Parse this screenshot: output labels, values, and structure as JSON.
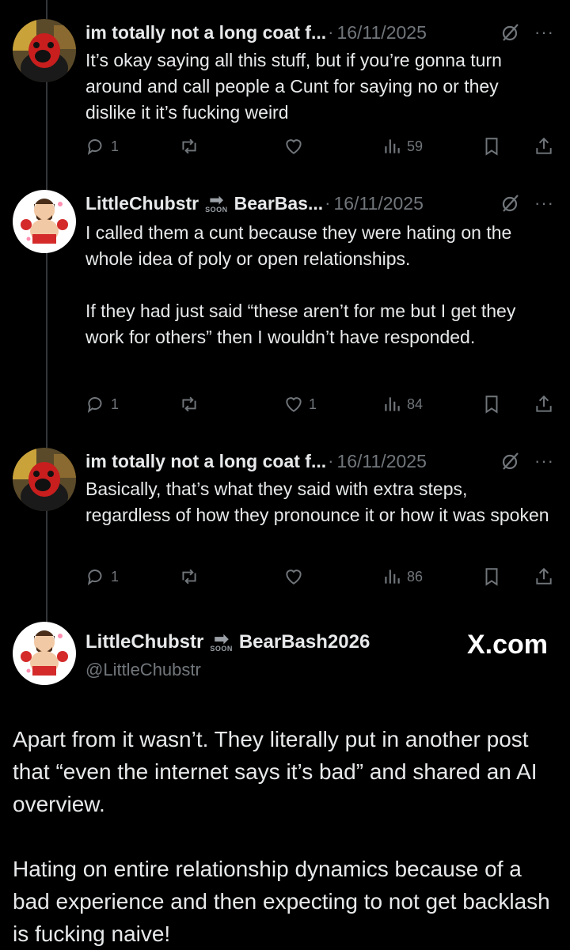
{
  "tweets": [
    {
      "name": "im totally not a long coat f...",
      "date": "16/11/2025",
      "text": "It’s okay saying all this stuff, but if you’re gonna turn around and call people a Cunt for saying no or they dislike it it’s fucking weird",
      "replies": "1",
      "reposts": "",
      "likes": "",
      "views": "59",
      "avatar": "red-mask-avatar"
    },
    {
      "name": "LittleChubstr",
      "name_suffix": "BearBas...",
      "soon_label": "SOON",
      "date": "16/11/2025",
      "text": "I called them a cunt because they were hating on the whole idea of poly or open relationships.\n\nIf they had just said “these aren’t for me but I get they work for others” then I wouldn’t have responded.",
      "replies": "1",
      "reposts": "",
      "likes": "1",
      "views": "84",
      "avatar": "cartoon-bear-avatar"
    },
    {
      "name": "im totally not a long coat f...",
      "date": "16/11/2025",
      "text": "Basically, that’s what they said with extra steps, regardless of how they pronounce it or how it was spoken",
      "replies": "1",
      "reposts": "",
      "likes": "",
      "views": "86",
      "avatar": "red-mask-avatar"
    }
  ],
  "quote": {
    "name": "LittleChubstr",
    "soon_label": "SOON",
    "name_suffix": "BearBash2026",
    "handle": "@LittleChubstr",
    "brand": "X.com",
    "text": "Apart from it wasn’t. They literally put in another post that “even the internet says it’s bad” and shared an AI overview.\n\nHating on entire relationship dynamics because of a bad experience and then expecting to not get backlash is fucking naive!"
  },
  "colors": {
    "background": "#000000",
    "text": "#e7e9ea",
    "muted": "#71767b",
    "thread_line": "#333639"
  }
}
